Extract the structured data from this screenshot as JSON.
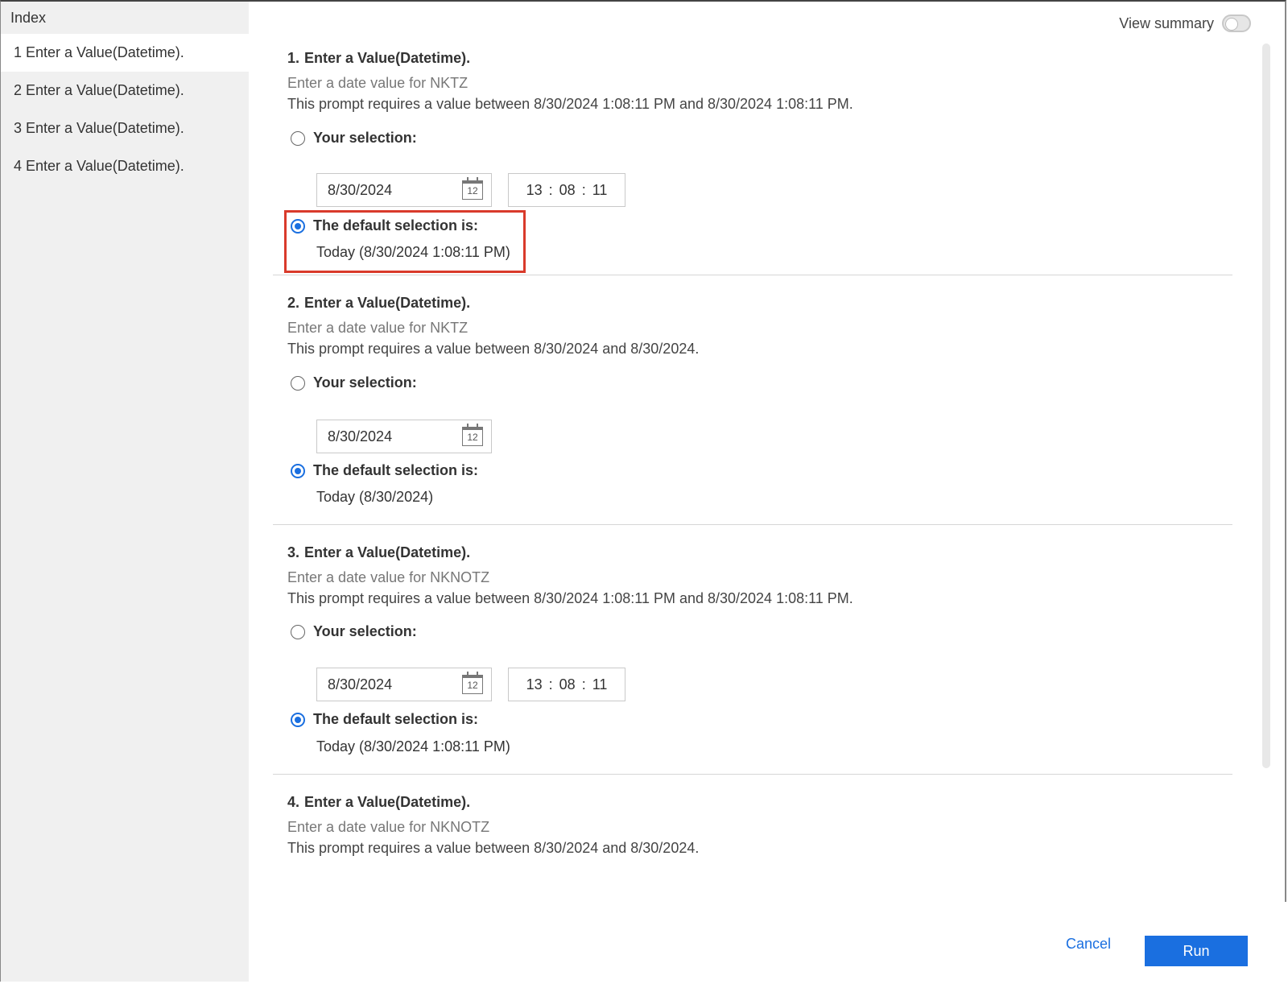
{
  "sidebar": {
    "title": "Index",
    "items": [
      {
        "label": "1 Enter a Value(Datetime)."
      },
      {
        "label": "2 Enter a Value(Datetime)."
      },
      {
        "label": "3 Enter a Value(Datetime)."
      },
      {
        "label": "4 Enter a Value(Datetime)."
      }
    ]
  },
  "header": {
    "view_summary_label": "View summary",
    "view_summary_on": false
  },
  "sections": [
    {
      "number": "1.",
      "title": "Enter a Value(Datetime).",
      "description": "Enter a date value for NKTZ",
      "requirement": "This prompt requires a value between 8/30/2024 1:08:11 PM and 8/30/2024 1:08:11 PM.",
      "your_selection_label": "Your selection:",
      "date_value": "8/30/2024",
      "calendar_icon_text": "12",
      "time": {
        "h": "13",
        "m": "08",
        "s": "11",
        "sep": ":"
      },
      "default_label": "The default selection is:",
      "default_value": "Today (8/30/2024 1:08:11 PM)"
    },
    {
      "number": "2.",
      "title": "Enter a Value(Datetime).",
      "description": "Enter a date value for NKTZ",
      "requirement": "This prompt requires a value between 8/30/2024 and 8/30/2024.",
      "your_selection_label": "Your selection:",
      "date_value": "8/30/2024",
      "calendar_icon_text": "12",
      "default_label": "The default selection is:",
      "default_value": "Today (8/30/2024)"
    },
    {
      "number": "3.",
      "title": "Enter a Value(Datetime).",
      "description": "Enter a date value for NKNOTZ",
      "requirement": "This prompt requires a value between 8/30/2024 1:08:11 PM and 8/30/2024 1:08:11 PM.",
      "your_selection_label": "Your selection:",
      "date_value": "8/30/2024",
      "calendar_icon_text": "12",
      "time": {
        "h": "13",
        "m": "08",
        "s": "11",
        "sep": ":"
      },
      "default_label": "The default selection is:",
      "default_value": "Today (8/30/2024 1:08:11 PM)"
    },
    {
      "number": "4.",
      "title": "Enter a Value(Datetime).",
      "description": "Enter a date value for NKNOTZ",
      "requirement": "This prompt requires a value between 8/30/2024 and 8/30/2024."
    }
  ],
  "footer": {
    "cancel_label": "Cancel",
    "run_label": "Run"
  },
  "colors": {
    "accent": "#1a6fe0",
    "highlight": "#d93a2b",
    "sidebar_bg": "#f0f0f0"
  }
}
